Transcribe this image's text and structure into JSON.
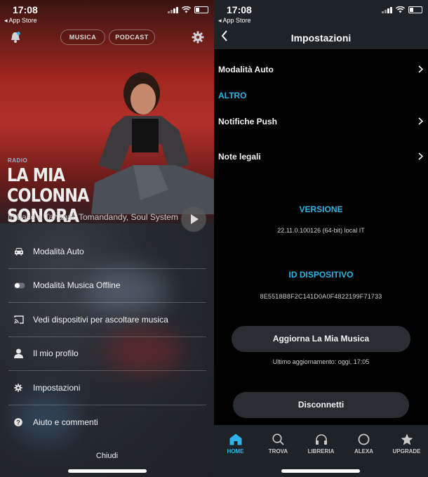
{
  "left_screen": {
    "status": {
      "time": "17:08",
      "back_app": "◂ App Store"
    },
    "top_nav": {
      "music_tab": "MUSICA",
      "podcast_tab": "PODCAST"
    },
    "hero": {
      "tag": "RADIO",
      "title_line1": "LA MIA COLONNA",
      "title_line2": "SONORA",
      "subtitle": "In base a Tananai, Tomandandy, Soul System"
    },
    "menu": [
      {
        "label": "Modalità Auto",
        "icon": "car-icon"
      },
      {
        "label": "Modalità  Musica Offline",
        "icon": "toggle-icon"
      },
      {
        "label": "Vedi dispositivi per ascoltare musica",
        "icon": "cast-icon"
      },
      {
        "label": "Il mio profilo",
        "icon": "person-icon"
      },
      {
        "label": "Impostazioni",
        "icon": "gear-icon"
      },
      {
        "label": "Aiuto e commenti",
        "icon": "help-icon"
      }
    ],
    "close_label": "Chiudi"
  },
  "right_screen": {
    "status": {
      "time": "17:08",
      "back_app": "◂ App Store"
    },
    "title": "Impostazioni",
    "rows": {
      "auto_mode": "Modalità Auto",
      "section_other": "ALTRO",
      "push": "Notifiche Push",
      "legal": "Note legali"
    },
    "version_label": "VERSIONE",
    "version_value": "22.11.0.100126 (64-bit) local IT",
    "device_id_label": "ID DISPOSITIVO",
    "device_id_value": "8E5518B8F2C141D0A0F4822199F71733",
    "refresh_button": "Aggiorna La Mia Musica",
    "last_update": "Ultimo aggiornamento: oggi, 17:05",
    "disconnect_button": "Disconnetti",
    "tabs": [
      {
        "label": "HOME",
        "icon": "home-icon",
        "active": true
      },
      {
        "label": "TROVA",
        "icon": "search-icon",
        "active": false
      },
      {
        "label": "LIBRERIA",
        "icon": "headphones-icon",
        "active": false
      },
      {
        "label": "ALEXA",
        "icon": "alexa-icon",
        "active": false
      },
      {
        "label": "UPGRADE",
        "icon": "star-icon",
        "active": false
      }
    ],
    "accent_color": "#2fb3e4"
  }
}
